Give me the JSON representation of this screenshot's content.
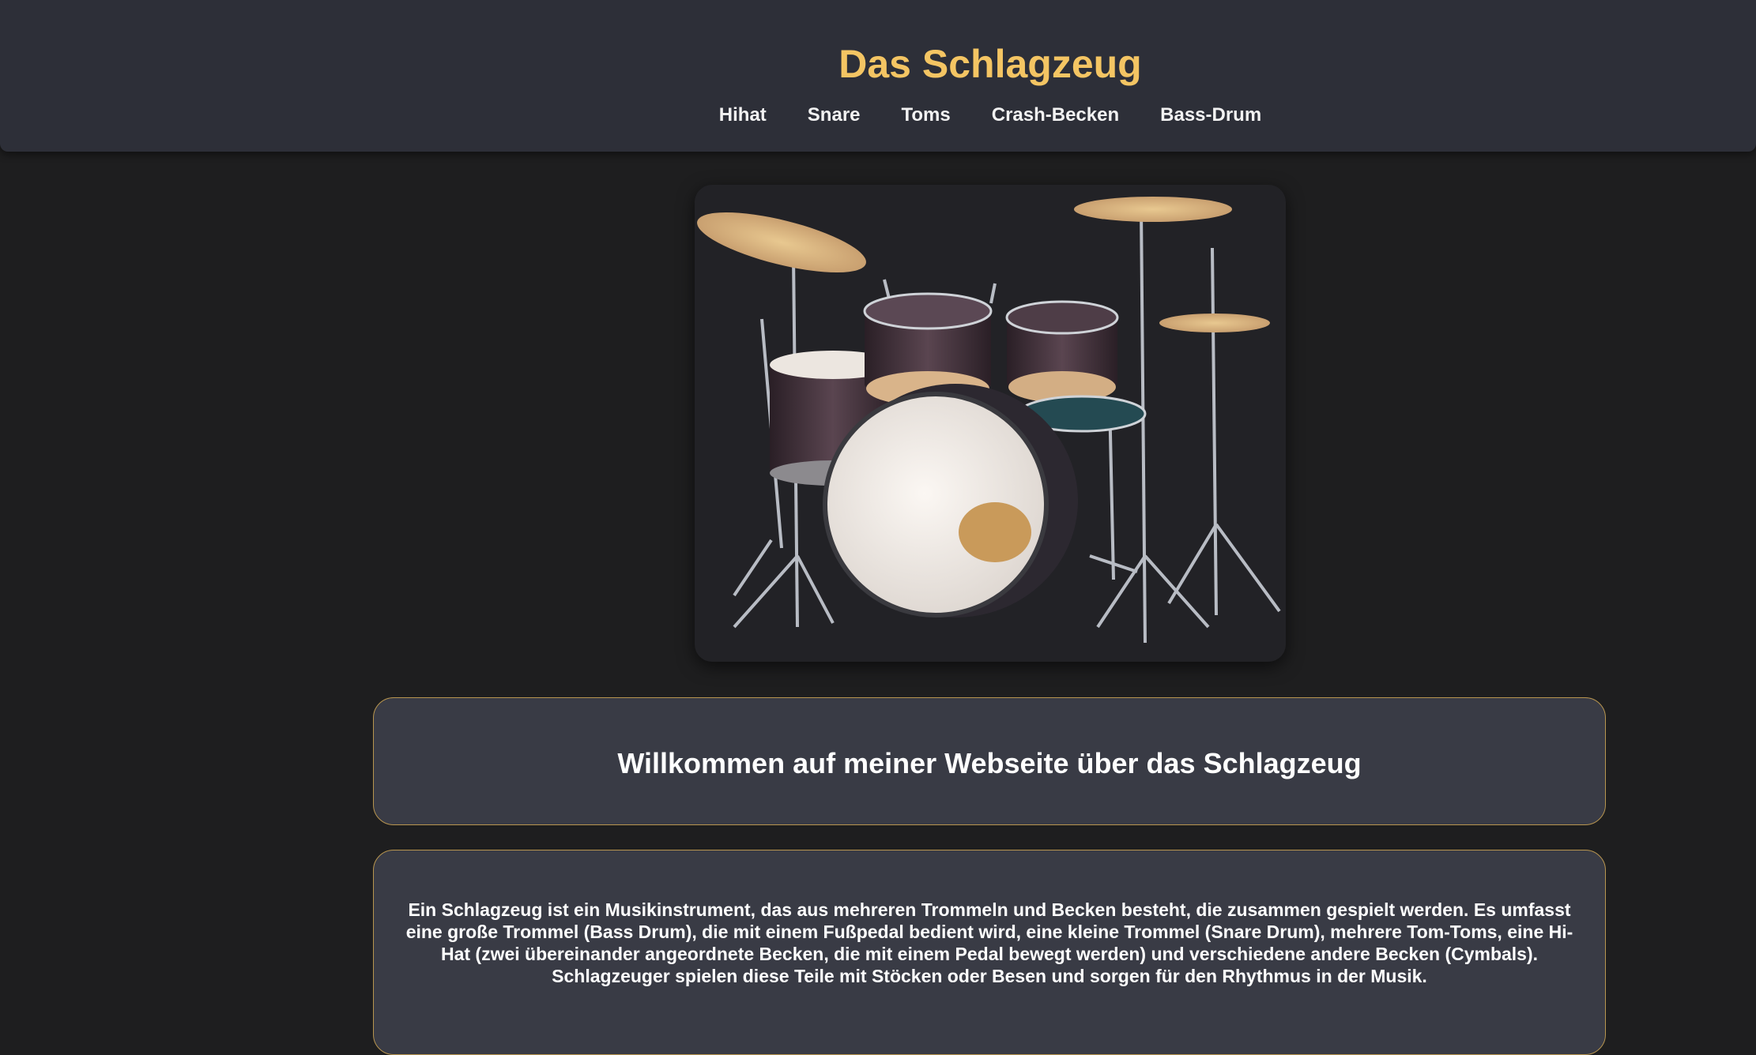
{
  "header": {
    "title": "Das Schlagzeug",
    "nav": [
      "Hihat",
      "Snare",
      "Toms",
      "Crash-Becken",
      "Bass-Drum"
    ]
  },
  "hero_image": {
    "subject": "drum kit photo"
  },
  "welcome": {
    "heading": "Willkommen auf meiner Webseite über das Schlagzeug"
  },
  "intro": {
    "text": "Ein Schlagzeug ist ein Musikinstrument, das aus mehreren Trommeln und Becken besteht, die zusammen gespielt werden. Es umfasst eine große Trommel (Bass Drum), die mit einem Fußpedal bedient wird, eine kleine Trommel (Snare Drum), mehrere Tom-Toms, eine Hi-Hat (zwei übereinander angeordnete Becken, die mit einem Pedal bewegt werden) und verschiedene andere Becken (Cymbals). Schlagzeuger spielen diese Teile mit Stöcken oder Besen und sorgen für den Rhythmus in der Musik."
  },
  "colors": {
    "background": "#1e1e1f",
    "header": "#2d2f38",
    "accent": "#f4c563",
    "card": "#393b45",
    "card_border": "#b8954f"
  }
}
